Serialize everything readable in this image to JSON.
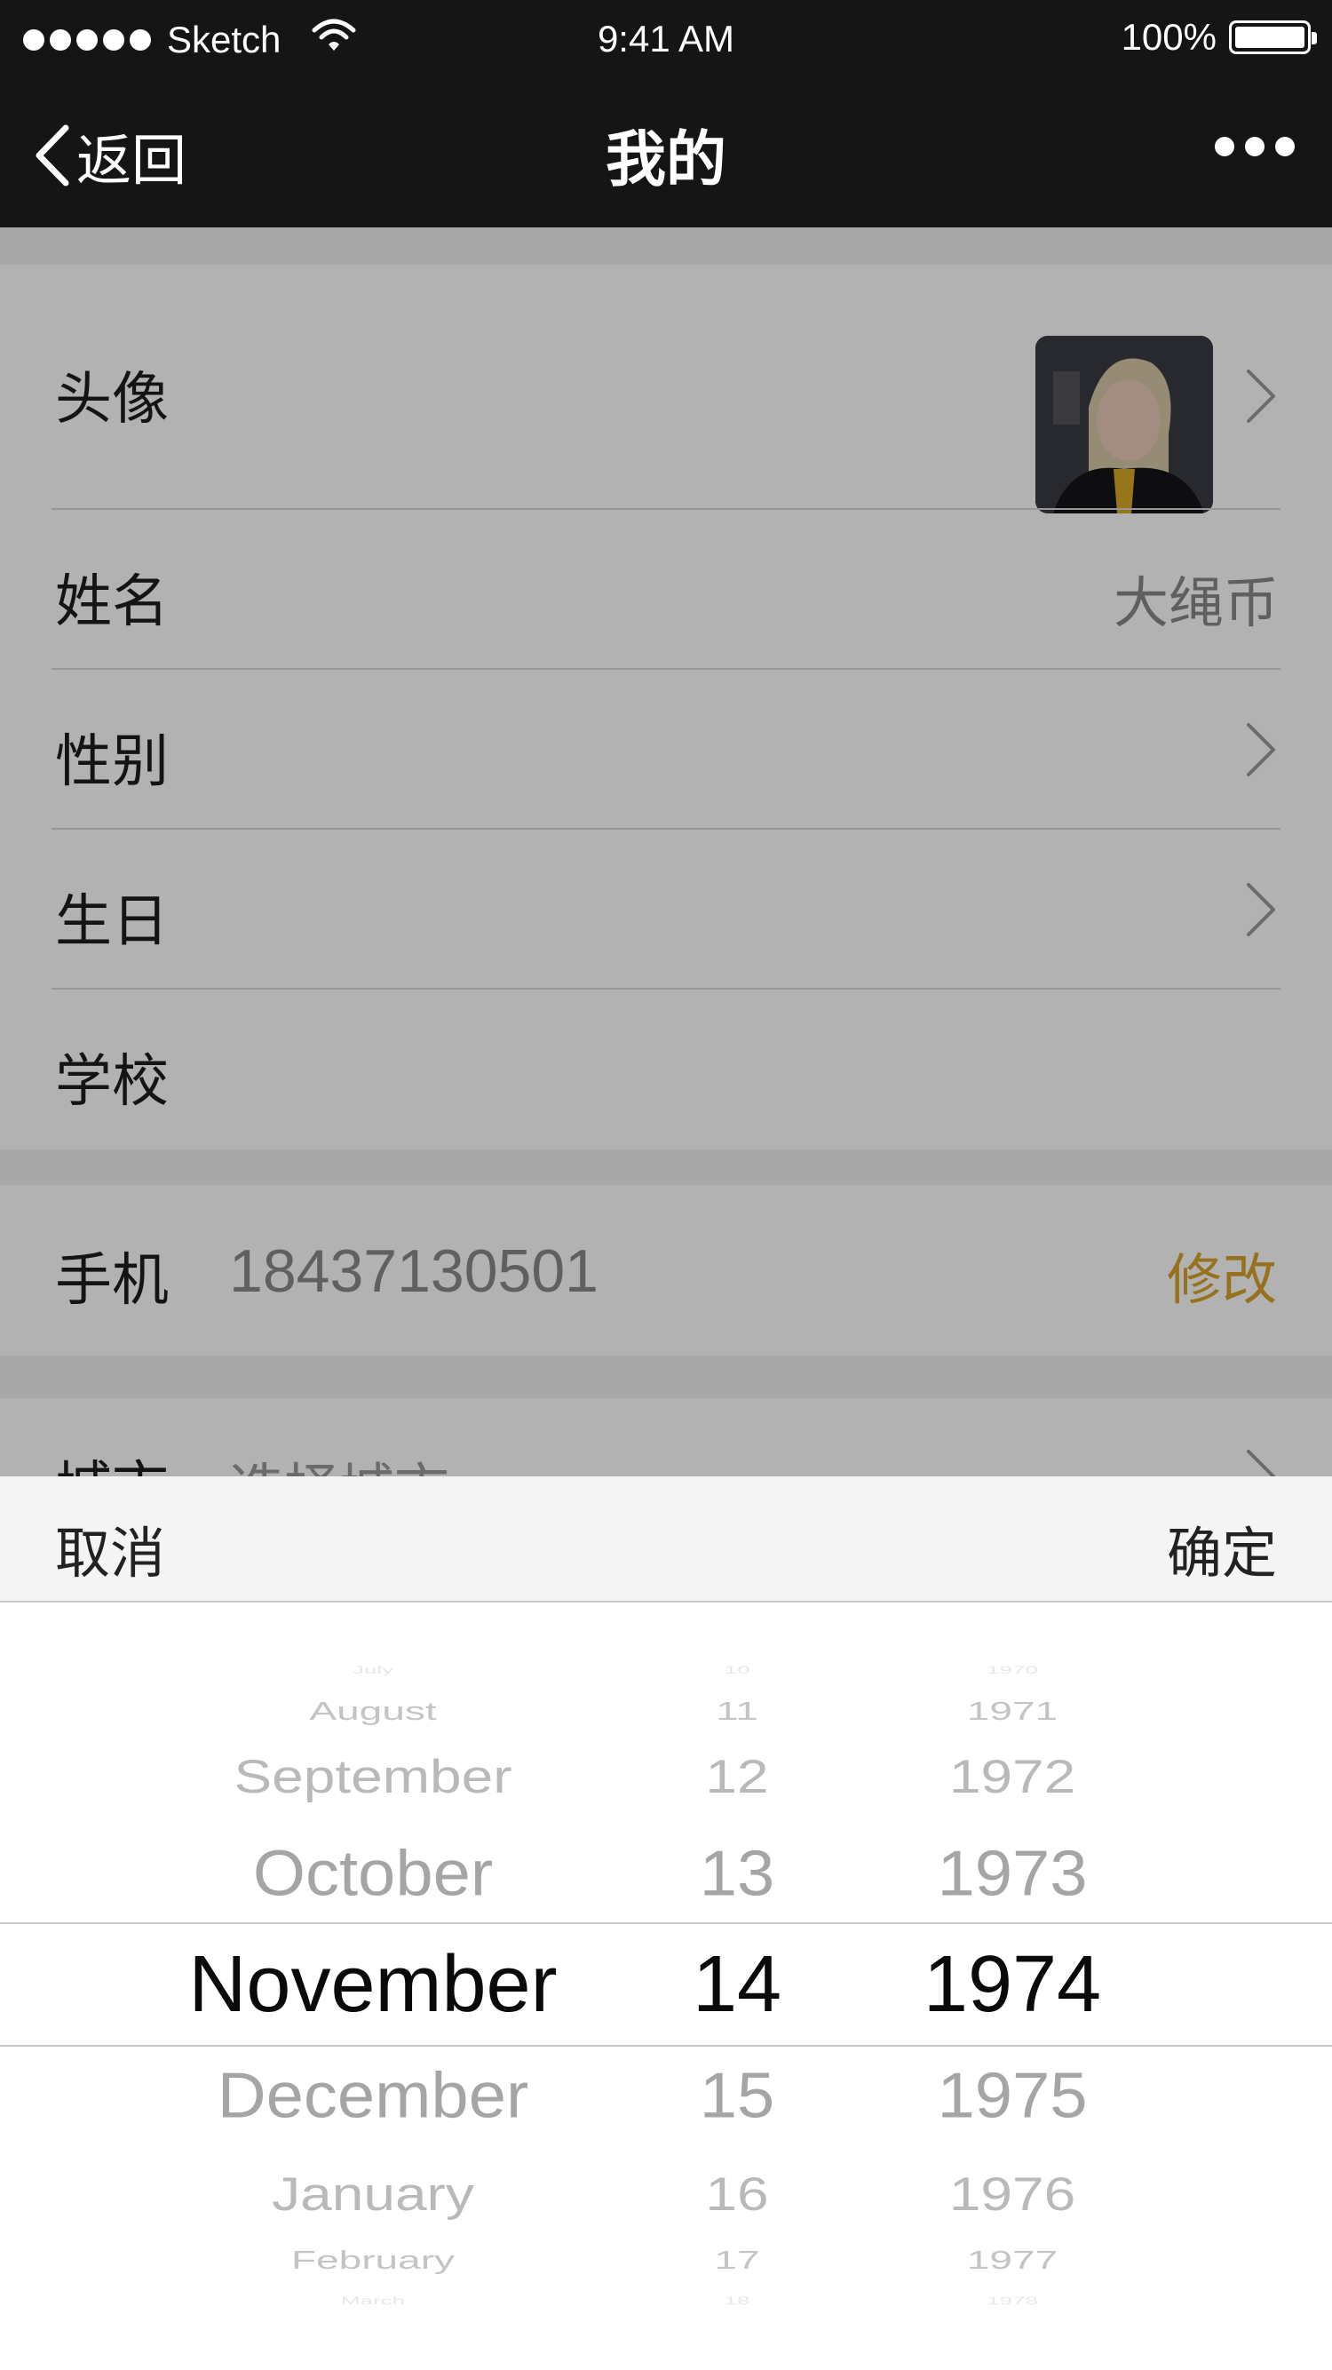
{
  "status_bar": {
    "carrier": "Sketch",
    "time": "9:41 AM",
    "battery": "100%"
  },
  "nav": {
    "back_label": "返回",
    "title": "我的"
  },
  "profile": {
    "avatar_label": "头像",
    "name_label": "姓名",
    "name_value": "大绳币",
    "gender_label": "性别",
    "birthday_label": "生日",
    "school_label": "学校"
  },
  "phone": {
    "label": "手机",
    "value": "18437130501",
    "edit_label": "修改"
  },
  "city": {
    "label": "城市",
    "placeholder": "选择城市"
  },
  "picker": {
    "cancel_label": "取消",
    "confirm_label": "确定",
    "months": [
      "July",
      "August",
      "September",
      "October",
      "November",
      "December",
      "January",
      "February",
      "March"
    ],
    "days": [
      "10",
      "11",
      "12",
      "13",
      "14",
      "15",
      "16",
      "17",
      "18"
    ],
    "years": [
      "1970",
      "1971",
      "1972",
      "1973",
      "1974",
      "1975",
      "1976",
      "1977",
      "1978"
    ],
    "selected_index": 4
  },
  "colors": {
    "accent": "#d9a22a",
    "nav_background": "#151516"
  }
}
